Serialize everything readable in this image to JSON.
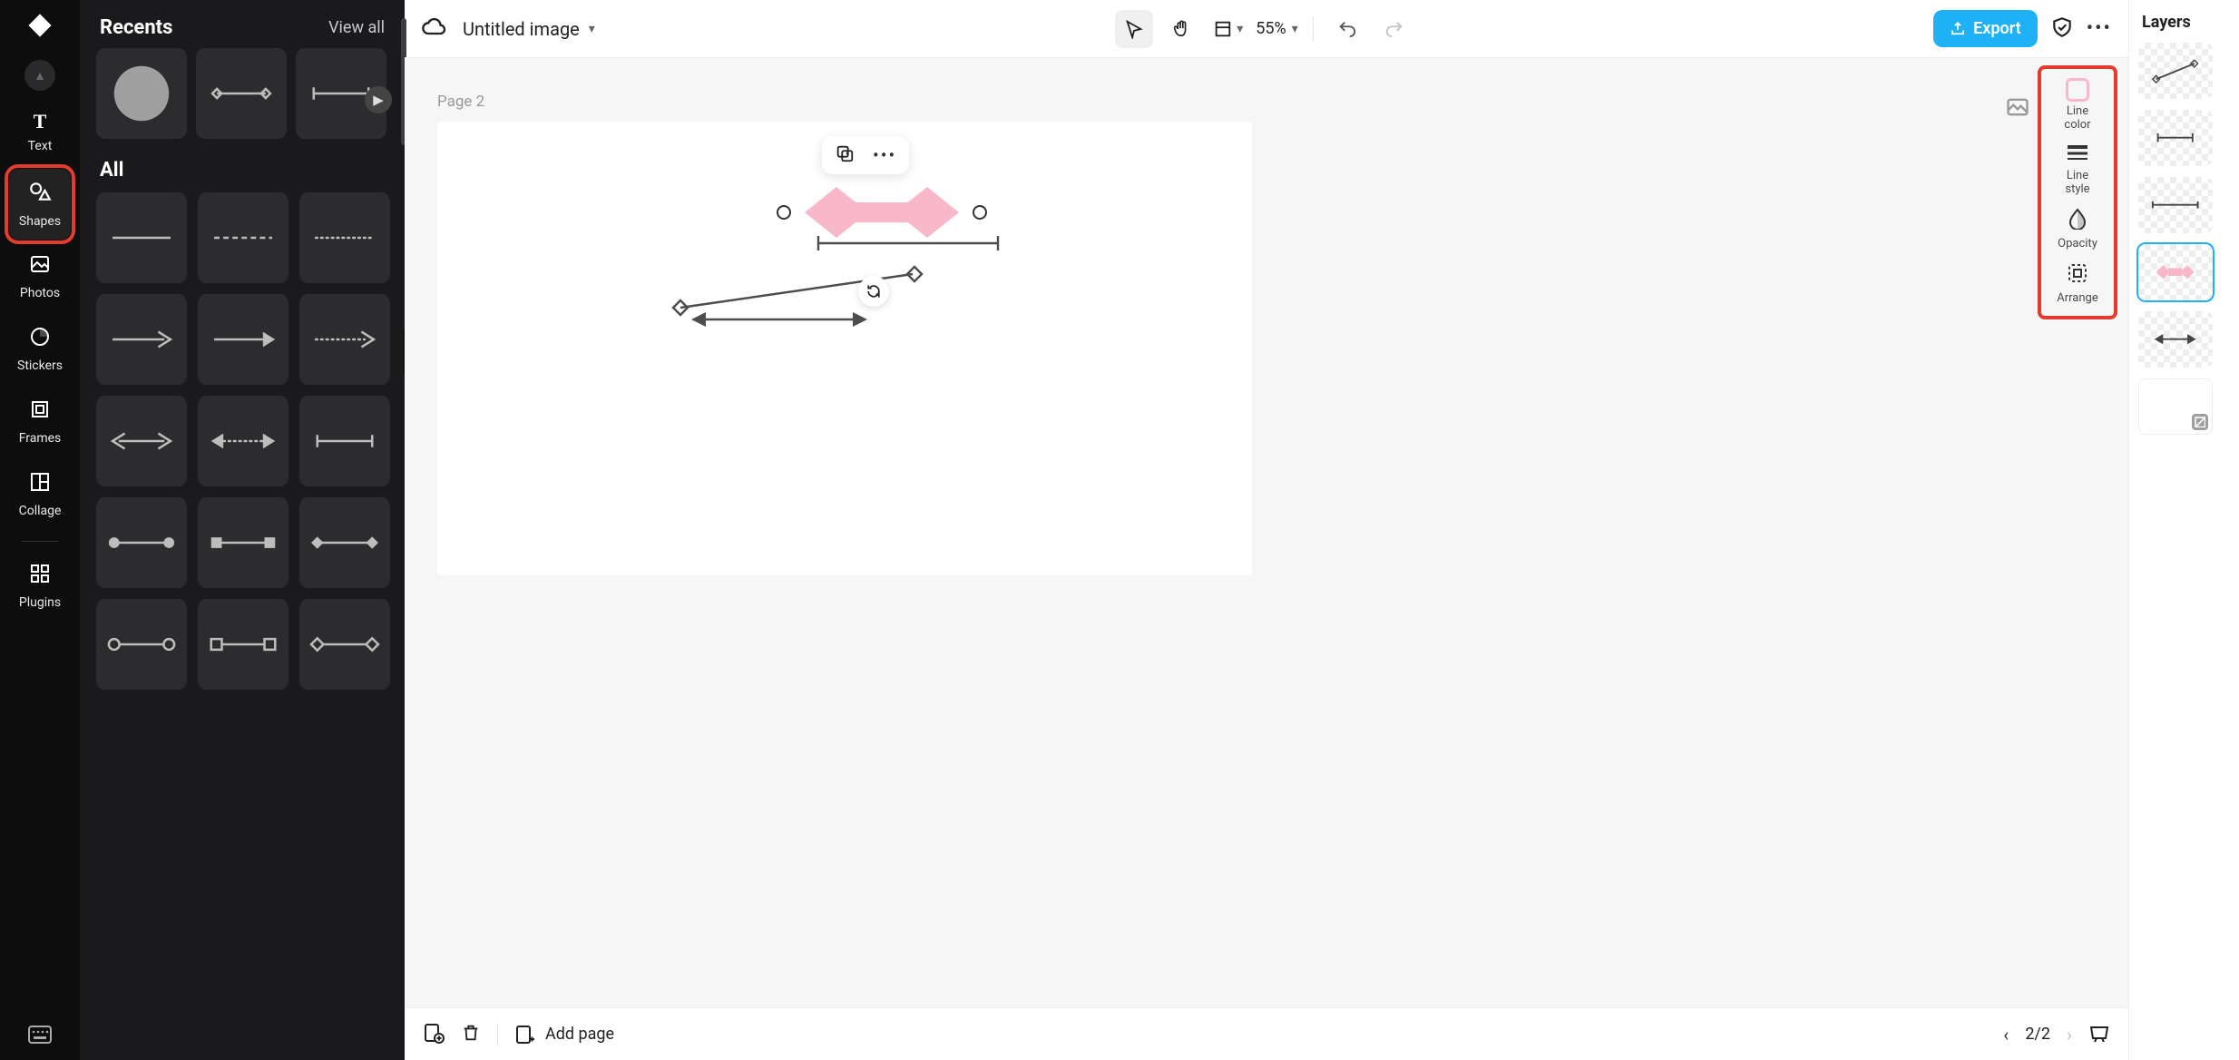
{
  "rail": {
    "collapse": "▲",
    "items": [
      {
        "id": "text",
        "label": "Text",
        "icon": "T"
      },
      {
        "id": "shapes",
        "label": "Shapes",
        "icon": "shapes",
        "active": true
      },
      {
        "id": "photos",
        "label": "Photos",
        "icon": "photo"
      },
      {
        "id": "stickers",
        "label": "Stickers",
        "icon": "sticker"
      },
      {
        "id": "frames",
        "label": "Frames",
        "icon": "frame"
      },
      {
        "id": "collage",
        "label": "Collage",
        "icon": "collage"
      },
      {
        "id": "plugins",
        "label": "Plugins",
        "icon": "plugins"
      }
    ]
  },
  "sidepanel": {
    "recents_title": "Recents",
    "view_all": "View all",
    "all_title": "All",
    "recents": [
      {
        "kind": "circle"
      },
      {
        "kind": "diamond-line"
      },
      {
        "kind": "bar-line"
      }
    ],
    "shapes": [
      {
        "kind": "solid-line"
      },
      {
        "kind": "dashed-line"
      },
      {
        "kind": "dotted-line"
      },
      {
        "kind": "arrow-open"
      },
      {
        "kind": "arrow-solid"
      },
      {
        "kind": "arrow-dotted"
      },
      {
        "kind": "double-arrow"
      },
      {
        "kind": "double-arrow-dotted"
      },
      {
        "kind": "bar-line"
      },
      {
        "kind": "dot-ends"
      },
      {
        "kind": "square-ends"
      },
      {
        "kind": "diamond-ends"
      },
      {
        "kind": "circle-open-ends"
      },
      {
        "kind": "square-open-ends"
      },
      {
        "kind": "diamond-open-ends"
      }
    ]
  },
  "header": {
    "title": "Untitled image",
    "zoom": "55%",
    "export_label": "Export"
  },
  "canvas": {
    "page_label": "Page 2"
  },
  "tools": {
    "line_color": "Line\ncolor",
    "line_style": "Line\nstyle",
    "opacity": "Opacity",
    "arrange": "Arrange",
    "swatch_color": "#f9b8ca"
  },
  "layers": {
    "title": "Layers",
    "items": [
      {
        "kind": "diag-diamond"
      },
      {
        "kind": "bar-line"
      },
      {
        "kind": "bar-line-long"
      },
      {
        "kind": "pink-diamond",
        "selected": true
      },
      {
        "kind": "double-arrow"
      },
      {
        "kind": "blank"
      }
    ]
  },
  "footer": {
    "add_page": "Add page",
    "page_indicator": "2/2"
  }
}
